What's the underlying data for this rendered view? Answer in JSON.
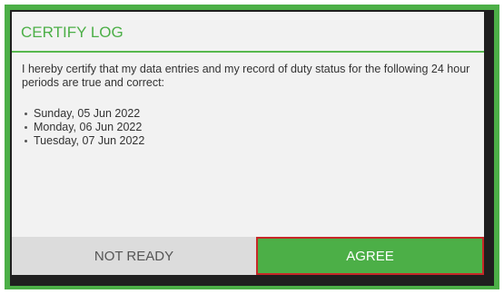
{
  "dialog": {
    "title": "CERTIFY LOG",
    "message": "I hereby certify that my data entries and my record of duty status for the following 24 hour periods are true and correct:",
    "dates": [
      "Sunday, 05 Jun 2022",
      "Monday, 06 Jun 2022",
      "Tuesday, 07 Jun 2022"
    ],
    "buttons": {
      "not_ready": "NOT READY",
      "agree": "AGREE"
    }
  },
  "colors": {
    "accent": "#4caf47",
    "highlight_border": "#c62828",
    "background_dark": "#1f1f1f",
    "dialog_background": "#f2f2f2",
    "secondary_button": "#dcdcdc"
  }
}
